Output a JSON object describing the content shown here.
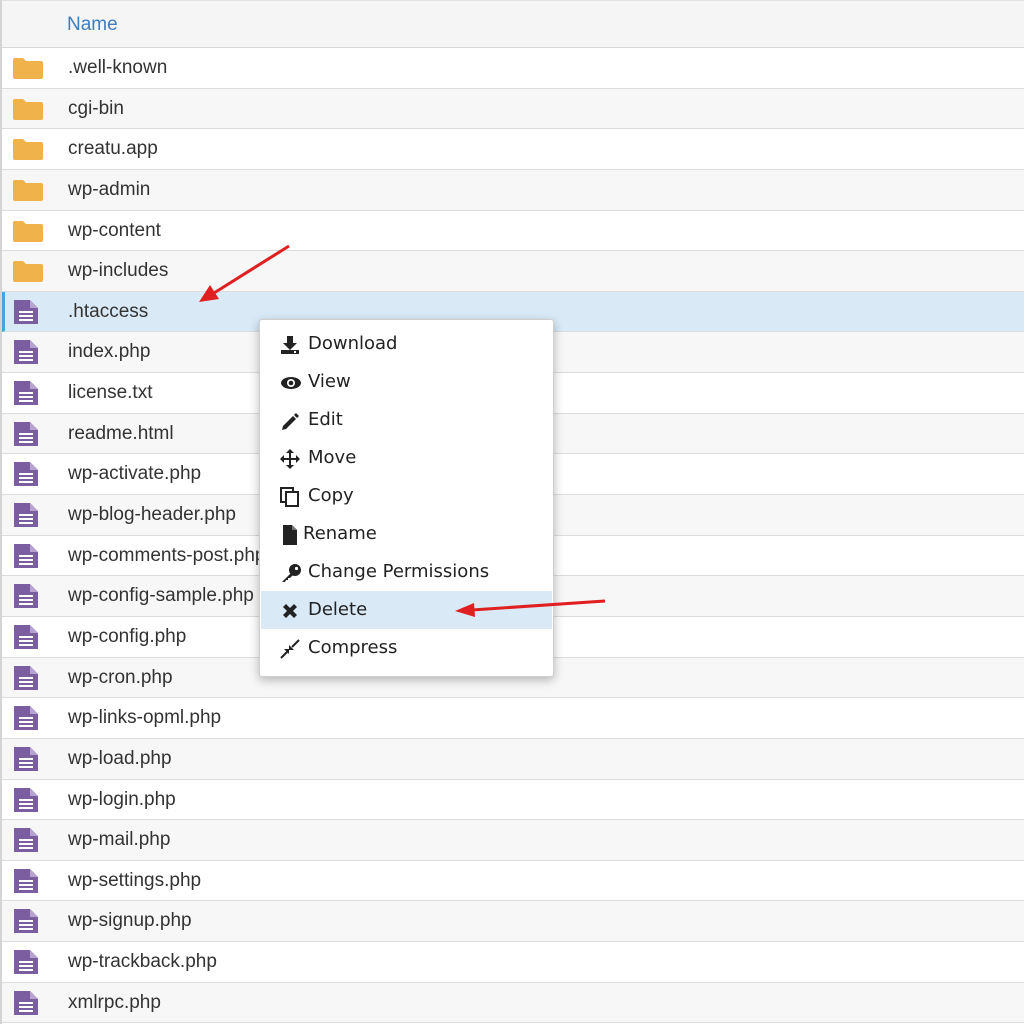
{
  "header": {
    "name_label": "Name"
  },
  "files": [
    {
      "name": ".well-known",
      "icon": "folder-icon"
    },
    {
      "name": "cgi-bin",
      "icon": "folder-icon"
    },
    {
      "name": "creatu.app",
      "icon": "folder-icon"
    },
    {
      "name": "wp-admin",
      "icon": "folder-icon"
    },
    {
      "name": "wp-content",
      "icon": "folder-icon"
    },
    {
      "name": "wp-includes",
      "icon": "folder-icon"
    },
    {
      "name": ".htaccess",
      "icon": "file-icon",
      "selected": true
    },
    {
      "name": "index.php",
      "icon": "file-icon"
    },
    {
      "name": "license.txt",
      "icon": "file-icon"
    },
    {
      "name": "readme.html",
      "icon": "file-icon"
    },
    {
      "name": "wp-activate.php",
      "icon": "file-icon"
    },
    {
      "name": "wp-blog-header.php",
      "icon": "file-icon"
    },
    {
      "name": "wp-comments-post.php",
      "icon": "file-icon"
    },
    {
      "name": "wp-config-sample.php",
      "icon": "file-icon"
    },
    {
      "name": "wp-config.php",
      "icon": "file-icon"
    },
    {
      "name": "wp-cron.php",
      "icon": "file-icon"
    },
    {
      "name": "wp-links-opml.php",
      "icon": "file-icon"
    },
    {
      "name": "wp-load.php",
      "icon": "file-icon"
    },
    {
      "name": "wp-login.php",
      "icon": "file-icon"
    },
    {
      "name": "wp-mail.php",
      "icon": "file-icon"
    },
    {
      "name": "wp-settings.php",
      "icon": "file-icon"
    },
    {
      "name": "wp-signup.php",
      "icon": "file-icon"
    },
    {
      "name": "wp-trackback.php",
      "icon": "file-icon"
    },
    {
      "name": "xmlrpc.php",
      "icon": "file-icon"
    }
  ],
  "context_menu": {
    "items": [
      {
        "label": "Download",
        "icon": "download-icon"
      },
      {
        "label": "View",
        "icon": "eye-icon"
      },
      {
        "label": "Edit",
        "icon": "pencil-icon"
      },
      {
        "label": "Move",
        "icon": "move-icon"
      },
      {
        "label": "Copy",
        "icon": "copy-icon"
      },
      {
        "label": "Rename",
        "icon": "file-icon"
      },
      {
        "label": "Change Permissions",
        "icon": "key-icon"
      },
      {
        "label": "Delete",
        "icon": "close-icon",
        "active": true
      },
      {
        "label": "Compress",
        "icon": "compress-icon"
      }
    ]
  },
  "colors": {
    "folder": "#f0b24a",
    "file": "#7b5ea0",
    "header_text": "#3e7dc0",
    "selected_row": "#d9eaf6",
    "annotation_arrow": "#e02020"
  }
}
